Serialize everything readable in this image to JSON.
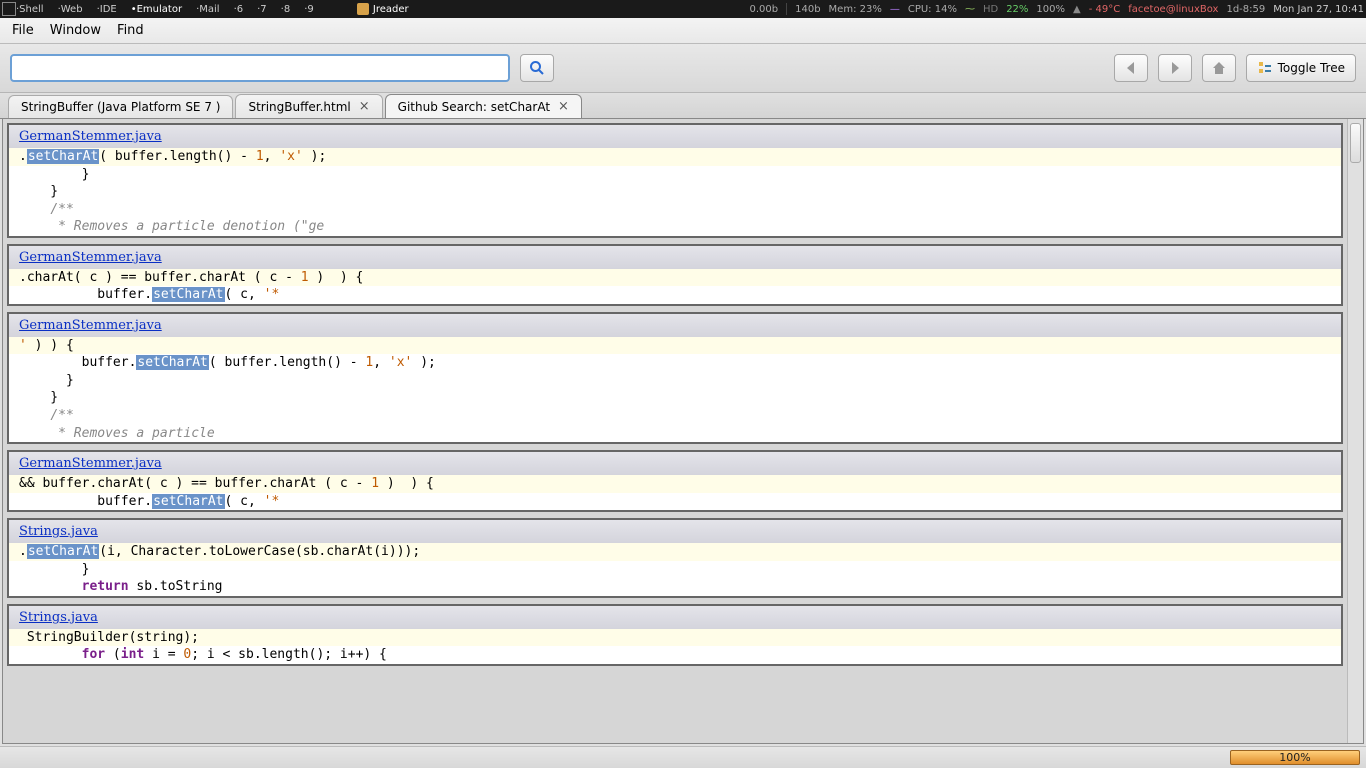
{
  "tray": {
    "workspaces": [
      "Shell",
      "Web",
      "IDE",
      "Emulator",
      "Mail",
      "6",
      "7",
      "8",
      "9"
    ],
    "current_ws": 3,
    "app_icon": "java-icon",
    "app_title": "Jreader",
    "net_down": "0.00b",
    "net_up": "140b",
    "mem": "Mem: 23%",
    "cpu": "CPU: 14%",
    "hd_label": "HD",
    "hd_pct": "22%",
    "batt": "100%",
    "temp": "- 49°C",
    "user": "facetoe@linuxBox",
    "uptime": "1d-8:59",
    "clock": "Mon Jan 27, 10:41"
  },
  "menu": {
    "items": [
      "File",
      "Window",
      "Find"
    ]
  },
  "toolbar": {
    "search_value": "",
    "search_placeholder": "",
    "toggle_label": "Toggle Tree"
  },
  "tabs": [
    {
      "label": "StringBuffer (Java Platform SE 7 )",
      "closable": false
    },
    {
      "label": "StringBuffer.html",
      "closable": true
    },
    {
      "label": "Github Search: setCharAt",
      "closable": true,
      "active": true
    }
  ],
  "results": [
    {
      "file": "GermanStemmer.java",
      "lines": [
        {
          "hl": true,
          "segs": [
            ".",
            {
              "mark": "setCharAt"
            },
            "( buffer.length() - ",
            {
              "num": "1"
            },
            ", ",
            {
              "str": "'x'"
            },
            " );"
          ]
        },
        {
          "hl": false,
          "segs": [
            "        }"
          ]
        },
        {
          "hl": false,
          "segs": [
            "    }"
          ]
        },
        {
          "hl": false,
          "segs": [
            ""
          ]
        },
        {
          "hl": false,
          "segs": [
            "    ",
            {
              "cmt": "/**"
            }
          ]
        },
        {
          "hl": false,
          "segs": [
            "     ",
            {
              "cmt": "* Removes a particle denotion (\"ge"
            }
          ]
        }
      ]
    },
    {
      "file": "GermanStemmer.java",
      "lines": [
        {
          "hl": true,
          "segs": [
            ".charAt( c ) == buffer.charAt ( c - ",
            {
              "num": "1"
            },
            " )  ) {"
          ]
        },
        {
          "hl": false,
          "segs": [
            "          buffer.",
            {
              "mark": "setCharAt"
            },
            "( c, ",
            {
              "str": "'*"
            }
          ]
        }
      ]
    },
    {
      "file": "GermanStemmer.java",
      "lines": [
        {
          "hl": true,
          "segs": [
            {
              "str": "'"
            },
            " ) ) {"
          ]
        },
        {
          "hl": false,
          "segs": [
            "        buffer.",
            {
              "mark": "setCharAt"
            },
            "( buffer.length() - ",
            {
              "num": "1"
            },
            ", ",
            {
              "str": "'x'"
            },
            " );"
          ]
        },
        {
          "hl": false,
          "segs": [
            "      }"
          ]
        },
        {
          "hl": false,
          "segs": [
            "    }"
          ]
        },
        {
          "hl": false,
          "segs": [
            ""
          ]
        },
        {
          "hl": false,
          "segs": [
            "    ",
            {
              "cmt": "/**"
            }
          ]
        },
        {
          "hl": false,
          "segs": [
            "     ",
            {
              "cmt": "* Removes a particle"
            }
          ]
        }
      ]
    },
    {
      "file": "GermanStemmer.java",
      "lines": [
        {
          "hl": true,
          "segs": [
            "&& buffer.charAt( c ) == buffer.charAt ( c - ",
            {
              "num": "1"
            },
            " )  ) {"
          ]
        },
        {
          "hl": false,
          "segs": [
            "          buffer.",
            {
              "mark": "setCharAt"
            },
            "( c, ",
            {
              "str": "'*"
            }
          ]
        }
      ]
    },
    {
      "file": "Strings.java",
      "lines": [
        {
          "hl": true,
          "segs": [
            ".",
            {
              "mark": "setCharAt"
            },
            "(i, Character.toLowerCase(sb.charAt(i)));"
          ]
        },
        {
          "hl": false,
          "segs": [
            "        }"
          ]
        },
        {
          "hl": false,
          "segs": [
            "        ",
            {
              "kw": "return"
            },
            " sb.toString"
          ]
        }
      ]
    },
    {
      "file": "Strings.java",
      "lines": [
        {
          "hl": true,
          "segs": [
            " StringBuilder(string);"
          ]
        },
        {
          "hl": false,
          "segs": [
            "        ",
            {
              "kw": "for"
            },
            " (",
            {
              "kw": "int"
            },
            " i = ",
            {
              "num": "0"
            },
            "; i < sb.length(); i++) {"
          ]
        }
      ]
    }
  ],
  "status": {
    "progress": "100%"
  }
}
